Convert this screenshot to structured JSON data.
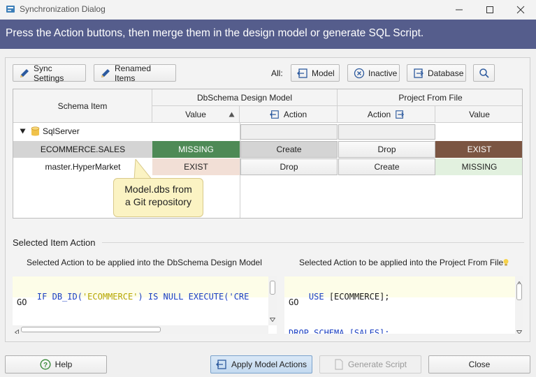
{
  "window": {
    "title": "Synchronization Dialog"
  },
  "banner": {
    "text": "Press the Action buttons, then merge them in the design model or generate SQL Script."
  },
  "toolbar": {
    "sync_settings": "Sync Settings",
    "renamed_items": "Renamed Items",
    "all_label": "All:",
    "model": "Model",
    "inactive": "Inactive",
    "database": "Database"
  },
  "grid": {
    "schema_item_header": "Schema Item",
    "left_group": "DbSchema Design Model",
    "right_group": "Project From File",
    "value_header": "Value",
    "action_header": "Action",
    "action_header_right": "Action",
    "value_header_right": "Value",
    "rows": [
      {
        "name": "SqlServer",
        "left_value": "",
        "left_action": "",
        "right_action": "",
        "right_value": ""
      },
      {
        "name": "ECOMMERCE.SALES",
        "left_value": "MISSING",
        "left_action": "Create",
        "right_action": "Drop",
        "right_value": "EXIST"
      },
      {
        "name": "master.HyperMarket",
        "left_value": "EXIST",
        "left_action": "Drop",
        "right_action": "Create",
        "right_value": "MISSING"
      }
    ]
  },
  "tooltip": {
    "line1": "Model.dbs from",
    "line2": "a Git repository"
  },
  "selected": {
    "section_label": "Selected Item Action",
    "left_caption": "Selected Action to be applied into the DbSchema Design Model",
    "right_caption": "Selected Action to be applied into the Project From File",
    "left_code": {
      "l1_kw1": "IF",
      "l1_fn": "DB_ID(",
      "l1_str": "'ECOMMERCE'",
      "l1_rest": ") IS NULL EXECUTE('CRE",
      "l2": "GO"
    },
    "right_code": {
      "l1_kw": "USE",
      "l1_id": "[ECOMMERCE];",
      "l2": "GO",
      "l3": "DROP SCHEMA [SALES];"
    }
  },
  "buttons": {
    "help": "Help",
    "apply": "Apply Model Actions",
    "generate": "Generate Script",
    "close": "Close"
  },
  "colors": {
    "banner": "#555d8c",
    "missing_green": "#4e8a56",
    "exist_brown": "#7b5542",
    "exist_pink": "#f2dfd6",
    "missing_light": "#e2f1df",
    "tooltip": "#fbf3c3",
    "row_selected": "#d4d4d4"
  }
}
